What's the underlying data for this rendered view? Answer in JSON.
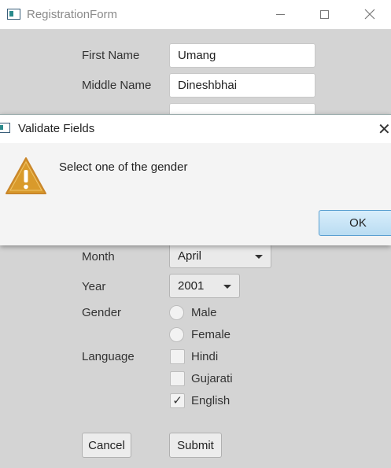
{
  "window": {
    "title": "RegistrationForm",
    "minimize_icon": "minimize-icon",
    "maximize_icon": "maximize-icon",
    "close_icon": "close-icon"
  },
  "form": {
    "first_name": {
      "label": "First Name",
      "value": "Umang"
    },
    "middle_name": {
      "label": "Middle Name",
      "value": "Dineshbhai"
    },
    "month": {
      "label": "Month",
      "value": "April"
    },
    "year": {
      "label": "Year",
      "value": "2001"
    },
    "gender": {
      "label": "Gender",
      "options": [
        "Male",
        "Female"
      ],
      "selected": null
    },
    "language": {
      "label": "Language",
      "options": [
        {
          "label": "Hindi",
          "checked": false
        },
        {
          "label": "Gujarati",
          "checked": false
        },
        {
          "label": "English",
          "checked": true
        }
      ]
    },
    "cancel_label": "Cancel",
    "submit_label": "Submit"
  },
  "dialog": {
    "title": "Validate Fields",
    "message": "Select one of the gender",
    "ok_label": "OK",
    "icon": "warning-icon",
    "close_glyph": "✕",
    "check_glyph": "✓"
  },
  "colors": {
    "background": "#d4d4d4",
    "accent": "#5a9fd0",
    "warning": "#d99a2b"
  }
}
